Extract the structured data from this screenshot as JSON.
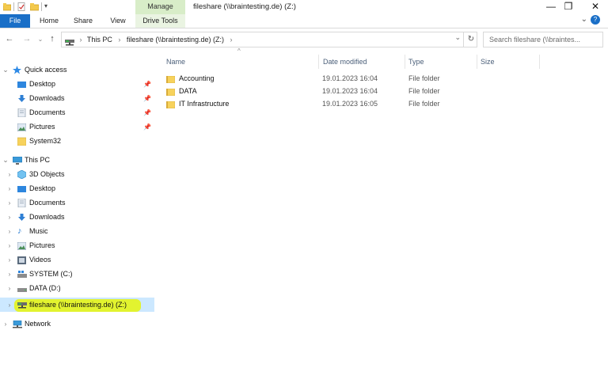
{
  "titlebar": {
    "manage_label": "Manage",
    "window_title": "fileshare (\\\\braintesting.de) (Z:)",
    "minimize": "—",
    "restore": "❐",
    "close": "✕"
  },
  "ribbon": {
    "tabs": [
      "File",
      "Home",
      "Share",
      "View",
      "Drive Tools"
    ],
    "expand_icon": "⌄",
    "help_icon": "?"
  },
  "navigation": {
    "back": "←",
    "forward": "→",
    "recent": "⌄",
    "up": "↑"
  },
  "address": {
    "crumbs": [
      "This PC",
      "fileshare (\\\\braintesting.de) (Z:)"
    ],
    "sep": "›",
    "dropdown": "⌄",
    "refresh": "↻"
  },
  "search": {
    "placeholder": "Search fileshare (\\\\braintes..."
  },
  "tree": {
    "quick_access": "Quick access",
    "quick_items": [
      "Desktop",
      "Downloads",
      "Documents",
      "Pictures",
      "System32"
    ],
    "this_pc": "This PC",
    "pc_items": [
      "3D Objects",
      "Desktop",
      "Documents",
      "Downloads",
      "Music",
      "Pictures",
      "Videos",
      "SYSTEM (C:)",
      "DATA (D:)",
      "fileshare (\\\\braintesting.de) (Z:)"
    ],
    "network": "Network"
  },
  "columns": {
    "name": "Name",
    "date": "Date modified",
    "type": "Type",
    "size": "Size",
    "sort_caret": "^"
  },
  "files": [
    {
      "name": "Accounting",
      "date": "19.01.2023 16:04",
      "type": "File folder"
    },
    {
      "name": "DATA",
      "date": "19.01.2023 16:04",
      "type": "File folder"
    },
    {
      "name": "IT Infrastructure",
      "date": "19.01.2023 16:05",
      "type": "File folder"
    }
  ],
  "colors": {
    "accent": "#1a6fc7",
    "selection": "#cce8ff",
    "highlighter": "#e5f50b",
    "manage_bg": "#d8edc8"
  }
}
